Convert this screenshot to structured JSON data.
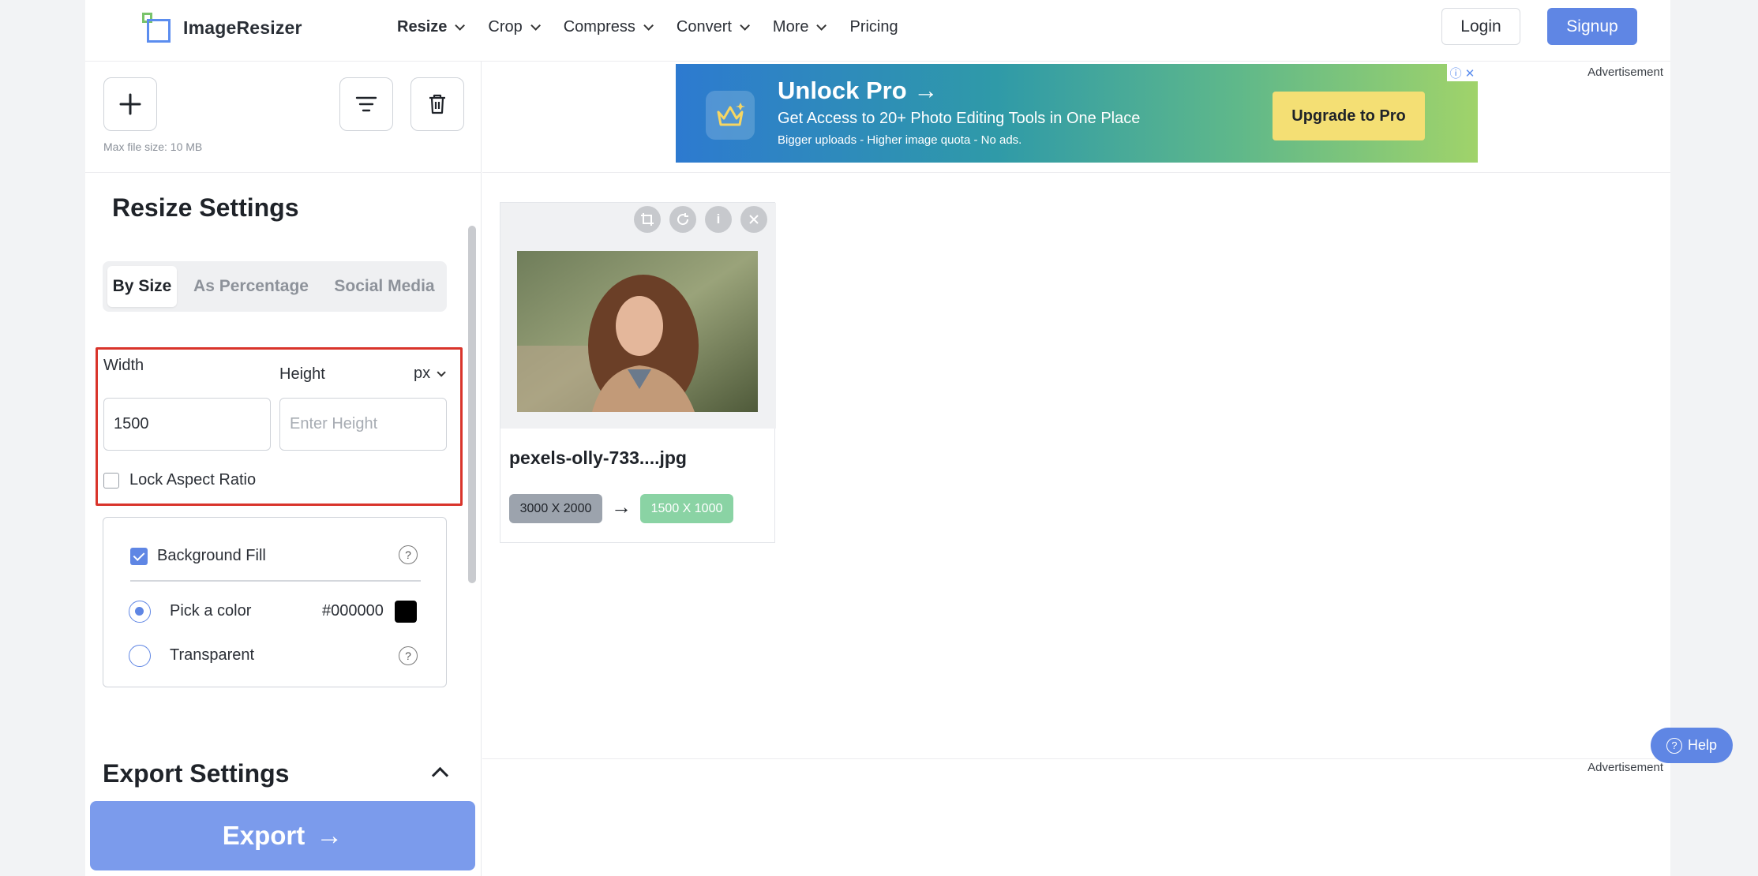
{
  "brand": {
    "name": "ImageResizer"
  },
  "nav": {
    "items": [
      {
        "label": "Resize"
      },
      {
        "label": "Crop"
      },
      {
        "label": "Compress"
      },
      {
        "label": "Convert"
      },
      {
        "label": "More"
      },
      {
        "label": "Pricing"
      }
    ],
    "login": "Login",
    "signup": "Signup"
  },
  "toolbar": {
    "max_file_size": "Max file size: 10 MB",
    "icons": [
      "plus-icon",
      "filter-icon",
      "trash-icon"
    ]
  },
  "resize_settings": {
    "title": "Resize Settings",
    "tabs": [
      "By Size",
      "As Percentage",
      "Social Media"
    ],
    "active_tab": "By Size",
    "width_label": "Width",
    "height_label": "Height",
    "unit": "px",
    "width_value": "1500",
    "height_placeholder": "Enter Height",
    "lock_aspect_label": "Lock Aspect Ratio",
    "lock_aspect_checked": false
  },
  "background": {
    "fill_label": "Background Fill",
    "fill_checked": true,
    "pick_color_label": "Pick a color",
    "color_hex": "#000000",
    "transparent_label": "Transparent",
    "selected": "Pick a color"
  },
  "export": {
    "settings_title": "Export Settings",
    "button_label": "Export",
    "arrow": "→"
  },
  "ads": {
    "label": "Advertisement",
    "banner": {
      "title": "Unlock Pro →",
      "subtitle": "Get Access to 20+ Photo Editing Tools in One Place",
      "small": "Bigger uploads - Higher image quota - No ads.",
      "cta": "Upgrade to Pro",
      "ad_controls": "ⓘ ✕"
    }
  },
  "image_card": {
    "filename": "pexels-olly-733....jpg",
    "original_size": "3000 X 2000",
    "arrow": "→",
    "new_size": "1500 X 1000",
    "controls": [
      "crop-icon",
      "rotate-icon",
      "info-icon",
      "close-icon"
    ]
  },
  "help": {
    "label": "Help"
  },
  "colors": {
    "accent": "#5f86e4",
    "export_button": "#7b9bec",
    "highlight_border": "#d9342b",
    "new_size_pill": "#8ad3a4",
    "old_size_pill": "#9ca3ad"
  }
}
